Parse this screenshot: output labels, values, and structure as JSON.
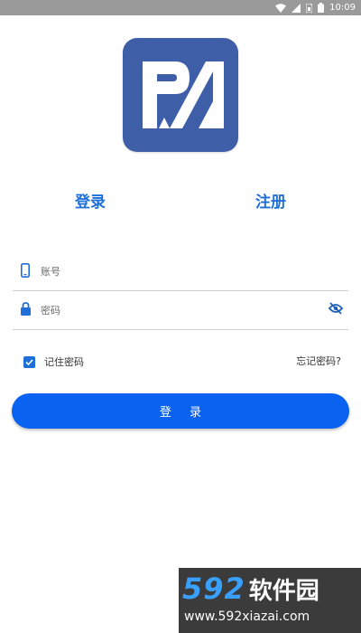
{
  "status_bar": {
    "time": "10:09"
  },
  "logo": {
    "text": "PM",
    "color": "#3e5fa8"
  },
  "tabs": [
    {
      "label": "登录"
    },
    {
      "label": "注册"
    }
  ],
  "form": {
    "account_placeholder": "账号",
    "password_placeholder": "密码",
    "remember_label": "记住密码",
    "remember_checked": true,
    "forgot_label": "忘记密码?",
    "login_button": "登 录"
  },
  "watermark": {
    "digits": "592",
    "text": "软件园",
    "url": "www.592xiazai.com"
  },
  "colors": {
    "accent": "#1e6fd8",
    "button": "#0a63f0"
  },
  "icons": [
    "wifi-icon",
    "signal-icon",
    "sim-icon",
    "battery-icon",
    "phone-icon",
    "lock-icon",
    "eye-off-icon",
    "check-icon"
  ]
}
